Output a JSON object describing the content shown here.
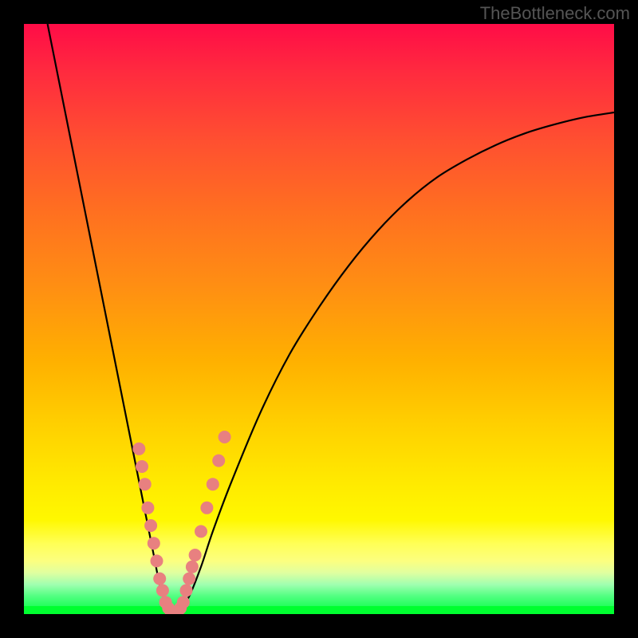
{
  "watermark": "TheBottleneck.com",
  "chart_data": {
    "type": "line",
    "title": "",
    "xlabel": "",
    "ylabel": "",
    "xlim": [
      0,
      100
    ],
    "ylim": [
      0,
      100
    ],
    "series": [
      {
        "name": "left-curve",
        "x": [
          4,
          6,
          8,
          10,
          12,
          14,
          16,
          18,
          20,
          22,
          23,
          24,
          25,
          26
        ],
        "y": [
          100,
          90,
          80,
          70,
          60,
          50,
          40,
          30,
          20,
          10,
          5,
          2,
          0,
          0
        ]
      },
      {
        "name": "right-curve",
        "x": [
          26,
          28,
          30,
          32,
          35,
          40,
          45,
          50,
          55,
          60,
          65,
          70,
          75,
          80,
          85,
          90,
          95,
          100
        ],
        "y": [
          0,
          3,
          8,
          14,
          22,
          34,
          44,
          52,
          59,
          65,
          70,
          74,
          77,
          79.5,
          81.5,
          83,
          84.2,
          85
        ]
      }
    ],
    "markers": {
      "name": "data-points",
      "color": "#e88080",
      "points": [
        {
          "x": 19.5,
          "y": 28
        },
        {
          "x": 20,
          "y": 25
        },
        {
          "x": 20.5,
          "y": 22
        },
        {
          "x": 21,
          "y": 18
        },
        {
          "x": 21.5,
          "y": 15
        },
        {
          "x": 22,
          "y": 12
        },
        {
          "x": 22.5,
          "y": 9
        },
        {
          "x": 23,
          "y": 6
        },
        {
          "x": 23.5,
          "y": 4
        },
        {
          "x": 24,
          "y": 2
        },
        {
          "x": 24.5,
          "y": 1
        },
        {
          "x": 25,
          "y": 0
        },
        {
          "x": 25.5,
          "y": 0
        },
        {
          "x": 26,
          "y": 0
        },
        {
          "x": 26.5,
          "y": 1
        },
        {
          "x": 27,
          "y": 2
        },
        {
          "x": 27.5,
          "y": 4
        },
        {
          "x": 28,
          "y": 6
        },
        {
          "x": 28.5,
          "y": 8
        },
        {
          "x": 29,
          "y": 10
        },
        {
          "x": 30,
          "y": 14
        },
        {
          "x": 31,
          "y": 18
        },
        {
          "x": 32,
          "y": 22
        },
        {
          "x": 33,
          "y": 26
        },
        {
          "x": 34,
          "y": 30
        }
      ]
    }
  }
}
